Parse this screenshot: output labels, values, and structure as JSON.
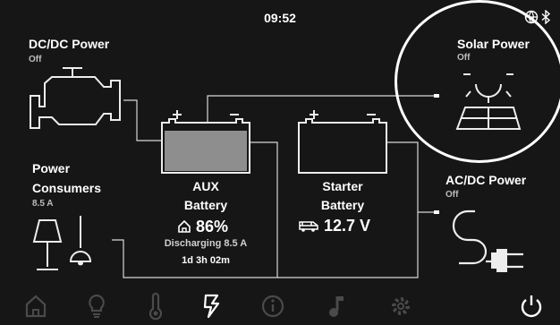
{
  "status_bar": {
    "time": "09:52",
    "icons": [
      "globe-icon",
      "bluetooth-icon"
    ]
  },
  "dcdc": {
    "title": "DC/DC Power",
    "status": "Off"
  },
  "solar": {
    "title": "Solar Power",
    "status": "Off"
  },
  "consumers": {
    "title_line1": "Power",
    "title_line2": "Consumers",
    "value": "8.5 A"
  },
  "acdc": {
    "title": "AC/DC Power",
    "status": "Off"
  },
  "aux": {
    "line1": "AUX",
    "line2": "Battery",
    "percent": "86%",
    "state": "Discharging 8.5 A",
    "remaining": "1d 3h 02m",
    "charge_level": 0.86
  },
  "starter": {
    "line1": "Starter",
    "line2": "Battery",
    "voltage": "12.7 V"
  },
  "nav": {
    "items": [
      "home-icon",
      "lightbulb-icon",
      "thermometer-icon",
      "power-flow-icon",
      "info-icon",
      "music-icon",
      "settings-icon",
      "power-icon"
    ],
    "active": "power-flow-icon"
  },
  "colors": {
    "background": "#161616",
    "foreground": "#ffffff",
    "muted": "#bdbdbd",
    "nav_inactive": "#4a4a4a",
    "battery_fill": "#8e8e8e"
  }
}
